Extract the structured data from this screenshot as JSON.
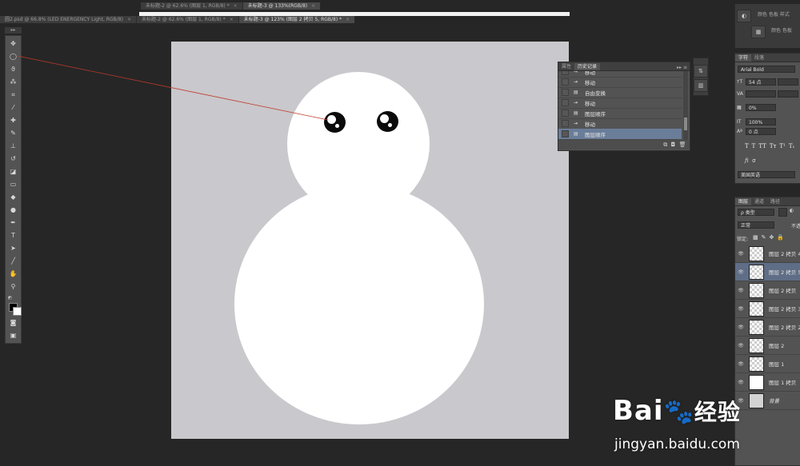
{
  "tabs_row1": [
    {
      "label": "未标题-2 @ 62.6% (图层 1, RGB/8) *",
      "active": false
    },
    {
      "label": "未标题-3 @ 133%(RGB/8)",
      "active": true
    }
  ],
  "tabs_row2": [
    {
      "label": "圆2.psd @ 66.8% (LED ENERGENCY Light, RGB/8)",
      "active": false
    },
    {
      "label": "未标题-2 @ 62.6% (图层 1, RGB/8) *",
      "active": false
    },
    {
      "label": "未标题-3 @ 123% (图层 2 拷贝 5, RGB/8) *",
      "active": true
    }
  ],
  "right_top_tabs": [
    "颜色",
    "色板",
    "样式",
    "颜色",
    "色板"
  ],
  "history_panel": {
    "tabs": [
      "属性",
      "历史记录"
    ],
    "items": [
      {
        "label": "移动",
        "icon": "move-icon",
        "selected": false
      },
      {
        "label": "移动",
        "icon": "move-icon",
        "selected": false
      },
      {
        "label": "自由变换",
        "icon": "transform-icon",
        "selected": false
      },
      {
        "label": "移动",
        "icon": "move-icon",
        "selected": false
      },
      {
        "label": "图层顺序",
        "icon": "layer-order-icon",
        "selected": false
      },
      {
        "label": "移动",
        "icon": "move-icon",
        "selected": false
      },
      {
        "label": "图层顺序",
        "icon": "layer-order-icon",
        "selected": true
      }
    ]
  },
  "character_panel": {
    "tabs": [
      "字符",
      "段落"
    ],
    "font_family": "Arial Bold",
    "font_size": "54 点",
    "tracking": "0%",
    "vertical_scale": "100%",
    "baseline_shift": "0 点",
    "language": "美国英语",
    "style_buttons": [
      "T",
      "T",
      "TT",
      "Tт",
      "T¹",
      "T₁"
    ]
  },
  "layers_panel": {
    "tabs": [
      "图层",
      "通道",
      "路径"
    ],
    "filter": "ρ 类型",
    "blend_mode": "正常",
    "opacity_label": "不透",
    "lock_label": "锁定:",
    "layers": [
      {
        "name": "图层 2 拷贝 4",
        "thumb": "transparent",
        "selected": false
      },
      {
        "name": "图层 2 拷贝 5",
        "thumb": "transparent",
        "selected": true
      },
      {
        "name": "图层 2 拷贝",
        "thumb": "transparent",
        "selected": false
      },
      {
        "name": "图层 2 拷贝 3",
        "thumb": "transparent",
        "selected": false
      },
      {
        "name": "图层 2 拷贝 2",
        "thumb": "transparent",
        "selected": false
      },
      {
        "name": "图层 2",
        "thumb": "transparent",
        "selected": false
      },
      {
        "name": "图层 1",
        "thumb": "transparent",
        "selected": false
      },
      {
        "name": "图层 1 拷贝",
        "thumb": "blob",
        "selected": false
      },
      {
        "name": "背景",
        "thumb": "background",
        "selected": false
      }
    ]
  },
  "watermark": {
    "brand_left": "Bai",
    "brand_right": "经验",
    "url": "jingyan.baidu.com"
  },
  "colors": {
    "workspace": "#262626",
    "panel": "#535353",
    "canvas": "#c9c8cc",
    "selected_row": "#6a7d99",
    "annotation_line": "#c0392b"
  }
}
